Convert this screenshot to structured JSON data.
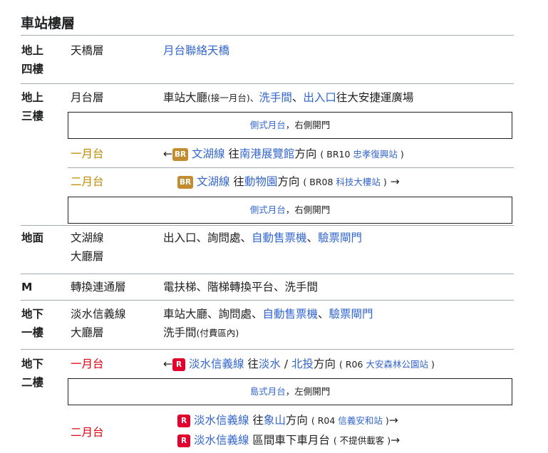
{
  "title": "車站樓層",
  "colors": {
    "link": "#3366cc",
    "brown_badge": "#c48c31",
    "red_badge": "#e3002c",
    "platform_orange": "#c08a00",
    "platform_red": "#e60012"
  },
  "rows": {
    "f4": {
      "label1": "地上",
      "label2": "四樓",
      "name": "天橋層",
      "link": "月台聯絡天橋"
    },
    "f3": {
      "label1": "地上",
      "label2": "三樓",
      "name": "月台層",
      "desc_a": "車站大廳",
      "desc_b": "(",
      "desc_c": "接一月台",
      "desc_d": ")、",
      "desc_link1": "洗手間",
      "desc_sep": "、",
      "desc_link2": "出入口",
      "desc_e": "往大安捷運廣場",
      "box1": "側式月台",
      "box1_sep": "，",
      "box1_rest": "右側開門",
      "p1": {
        "name": "一月台",
        "arrow": "←",
        "badge": "BR",
        "line": "文湖線",
        "to": "往",
        "dest": "南港展覽館",
        "dir": "方向",
        "paren_open": "(",
        "code": "BR10",
        "station": "忠孝復興站",
        "paren_close": ")"
      },
      "p2": {
        "name": "二月台",
        "badge": "BR",
        "line": "文湖線",
        "to": "往",
        "dest": "動物園",
        "dir": "方向",
        "paren_open": "(",
        "code": "BR08",
        "station": "科技大樓站",
        "paren_close": ")",
        "arrow": "→"
      },
      "box2": "側式月台",
      "box2_sep": "，",
      "box2_rest": "右側開門"
    },
    "g": {
      "label": "地面",
      "name1": "文湖線",
      "name2": "大廳層",
      "desc_a": "出入口、詢問處、",
      "desc_link1": "自動售票機",
      "desc_sep": "、",
      "desc_link2": "驗票閘門"
    },
    "m": {
      "label": "M",
      "name": "轉換連通層",
      "desc": "電扶梯、階梯轉換平台、洗手間"
    },
    "b1": {
      "label1": "地下",
      "label2": "一樓",
      "name1": "淡水信義線",
      "name2": "大廳層",
      "desc_a": "車站大廳、詢問處、",
      "desc_link1": "自動售票機",
      "desc_sep": "、",
      "desc_link2": "驗票閘門",
      "desc2_a": "洗手間",
      "desc2_b": "(",
      "desc2_c": "付費區內",
      "desc2_d": ")"
    },
    "b2": {
      "label1": "地下",
      "label2": "二樓",
      "p1": {
        "name": "一月台",
        "arrow": "←",
        "badge": "R",
        "line": "淡水信義線",
        "to": "往",
        "dest1": "淡水",
        "slash": "/",
        "dest2": "北投",
        "dir": "方向",
        "paren_open": "(",
        "code": "R06",
        "station": "大安森林公園站",
        "paren_close": ")"
      },
      "box": "島式月台",
      "box_sep": "，",
      "box_rest": "左側開門",
      "p2": {
        "name": "二月台",
        "a": {
          "badge": "R",
          "line": "淡水信義線",
          "to": "往",
          "dest": "象山",
          "dir": "方向",
          "paren_open": "(",
          "code": "R04",
          "station": "信義安和站",
          "paren_close": ")",
          "arrow": "→"
        },
        "b": {
          "badge": "R",
          "line": "淡水信義線",
          "text": "區間車下車月台",
          "paren_open": "(",
          "note": "不提供載客",
          "paren_close": ")",
          "arrow": "→"
        }
      }
    }
  }
}
